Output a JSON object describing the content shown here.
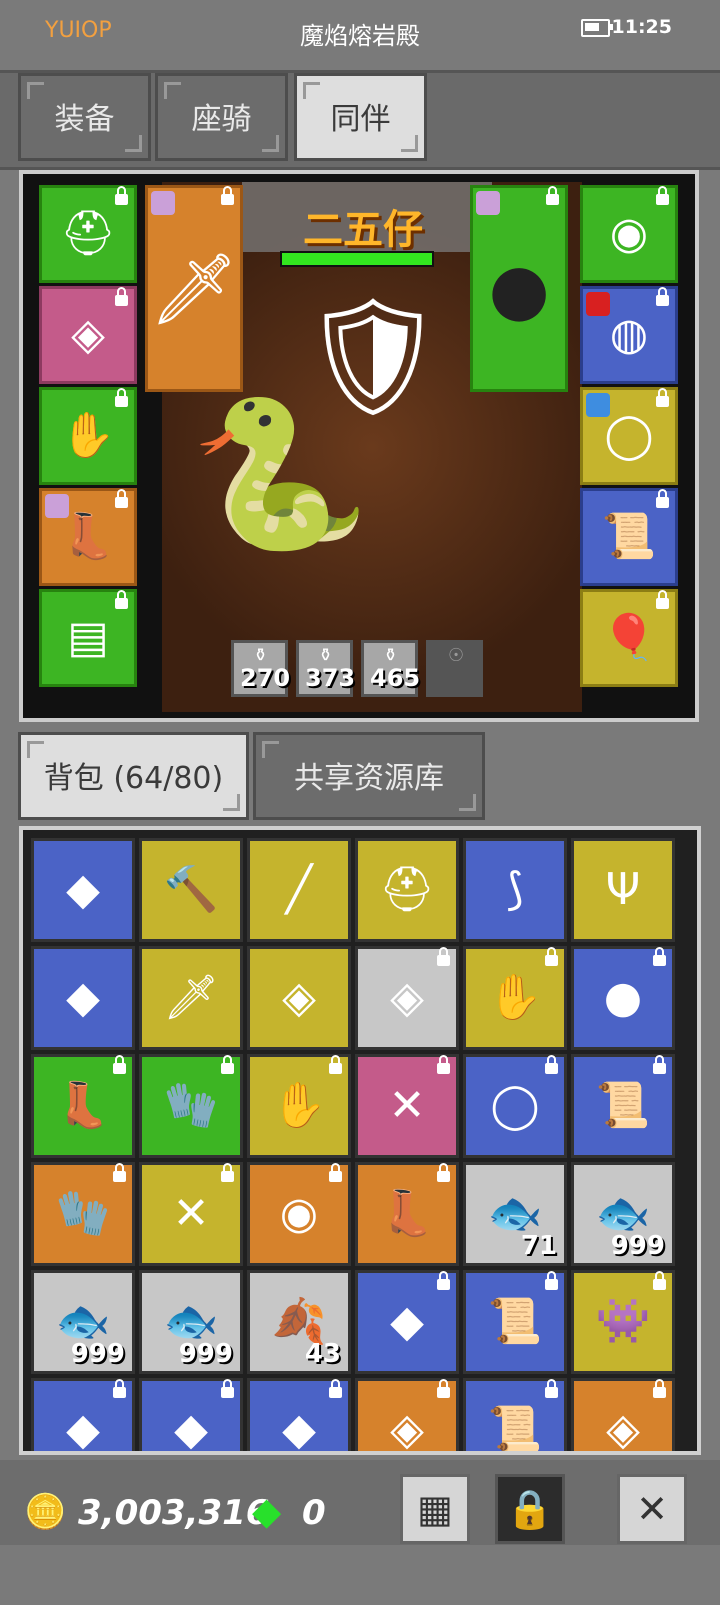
{
  "status": {
    "brand": "YUIOP",
    "title": "魔焰熔岩殿",
    "time": "11:25"
  },
  "tabs": [
    {
      "label": "装备"
    },
    {
      "label": "座骑"
    },
    {
      "label": "同伴"
    }
  ],
  "companion": {
    "name": "二五仔"
  },
  "potions": [
    "270",
    "373",
    "465"
  ],
  "bag_tabs": [
    {
      "label": "背包 (64/80)"
    },
    {
      "label": "共享资源库"
    }
  ],
  "grid": {
    "rows": [
      [
        {
          "icon": "gem-icon",
          "color": "blue"
        },
        {
          "icon": "hammer-icon",
          "color": "yellow"
        },
        {
          "icon": "spear-icon",
          "color": "yellow"
        },
        {
          "icon": "helmet-icon",
          "color": "yellow"
        },
        {
          "icon": "bow-icon",
          "color": "blue"
        },
        {
          "icon": "trident-icon",
          "color": "yellow"
        }
      ],
      [
        {
          "icon": "gem-icon",
          "color": "blue"
        },
        {
          "icon": "sword-icon",
          "color": "yellow"
        },
        {
          "icon": "armor-icon",
          "color": "yellow"
        },
        {
          "icon": "armor-icon",
          "color": "gray",
          "lock": true
        },
        {
          "icon": "gauntlet-icon",
          "color": "yellow",
          "lock": true
        },
        {
          "icon": "shield-icon",
          "color": "blue",
          "lock": true
        }
      ],
      [
        {
          "icon": "boots-icon",
          "color": "green",
          "lock": true
        },
        {
          "icon": "gloves-icon",
          "color": "green",
          "lock": true
        },
        {
          "icon": "gauntlet-icon",
          "color": "yellow",
          "lock": true
        },
        {
          "icon": "crossbow-icon",
          "color": "pink",
          "lock": true
        },
        {
          "icon": "ring-icon",
          "color": "blue",
          "lock": true
        },
        {
          "icon": "scroll-icon",
          "color": "blue",
          "lock": true
        }
      ],
      [
        {
          "icon": "gloves-icon",
          "color": "orange",
          "lock": true
        },
        {
          "icon": "crossbow-icon",
          "color": "yellow",
          "lock": true
        },
        {
          "icon": "necklace-icon",
          "color": "orange",
          "lock": true
        },
        {
          "icon": "boots-icon",
          "color": "orange",
          "lock": true
        },
        {
          "icon": "fish-icon",
          "color": "gray",
          "count": "71"
        },
        {
          "icon": "fish-icon",
          "color": "gray",
          "count": "999"
        }
      ],
      [
        {
          "icon": "fish-icon",
          "color": "gray",
          "count": "999"
        },
        {
          "icon": "fish-icon",
          "color": "gray",
          "count": "999"
        },
        {
          "icon": "leaf-icon",
          "color": "gray",
          "count": "43"
        },
        {
          "icon": "gem-icon",
          "color": "blue",
          "lock": true
        },
        {
          "icon": "scroll-icon",
          "color": "blue",
          "lock": true
        },
        {
          "icon": "monster-icon",
          "color": "yellow",
          "lock": true
        }
      ],
      [
        {
          "icon": "gem-icon",
          "color": "blue",
          "lock": true
        },
        {
          "icon": "gem-icon",
          "color": "blue",
          "lock": true
        },
        {
          "icon": "gem-icon",
          "color": "blue",
          "lock": true
        },
        {
          "icon": "armor-icon",
          "color": "orange",
          "lock": true
        },
        {
          "icon": "scroll-icon",
          "color": "blue",
          "lock": true
        },
        {
          "icon": "armor-icon",
          "color": "orange",
          "lock": true
        }
      ]
    ]
  },
  "currency": {
    "gold": "3,003,316",
    "gems": "0"
  }
}
